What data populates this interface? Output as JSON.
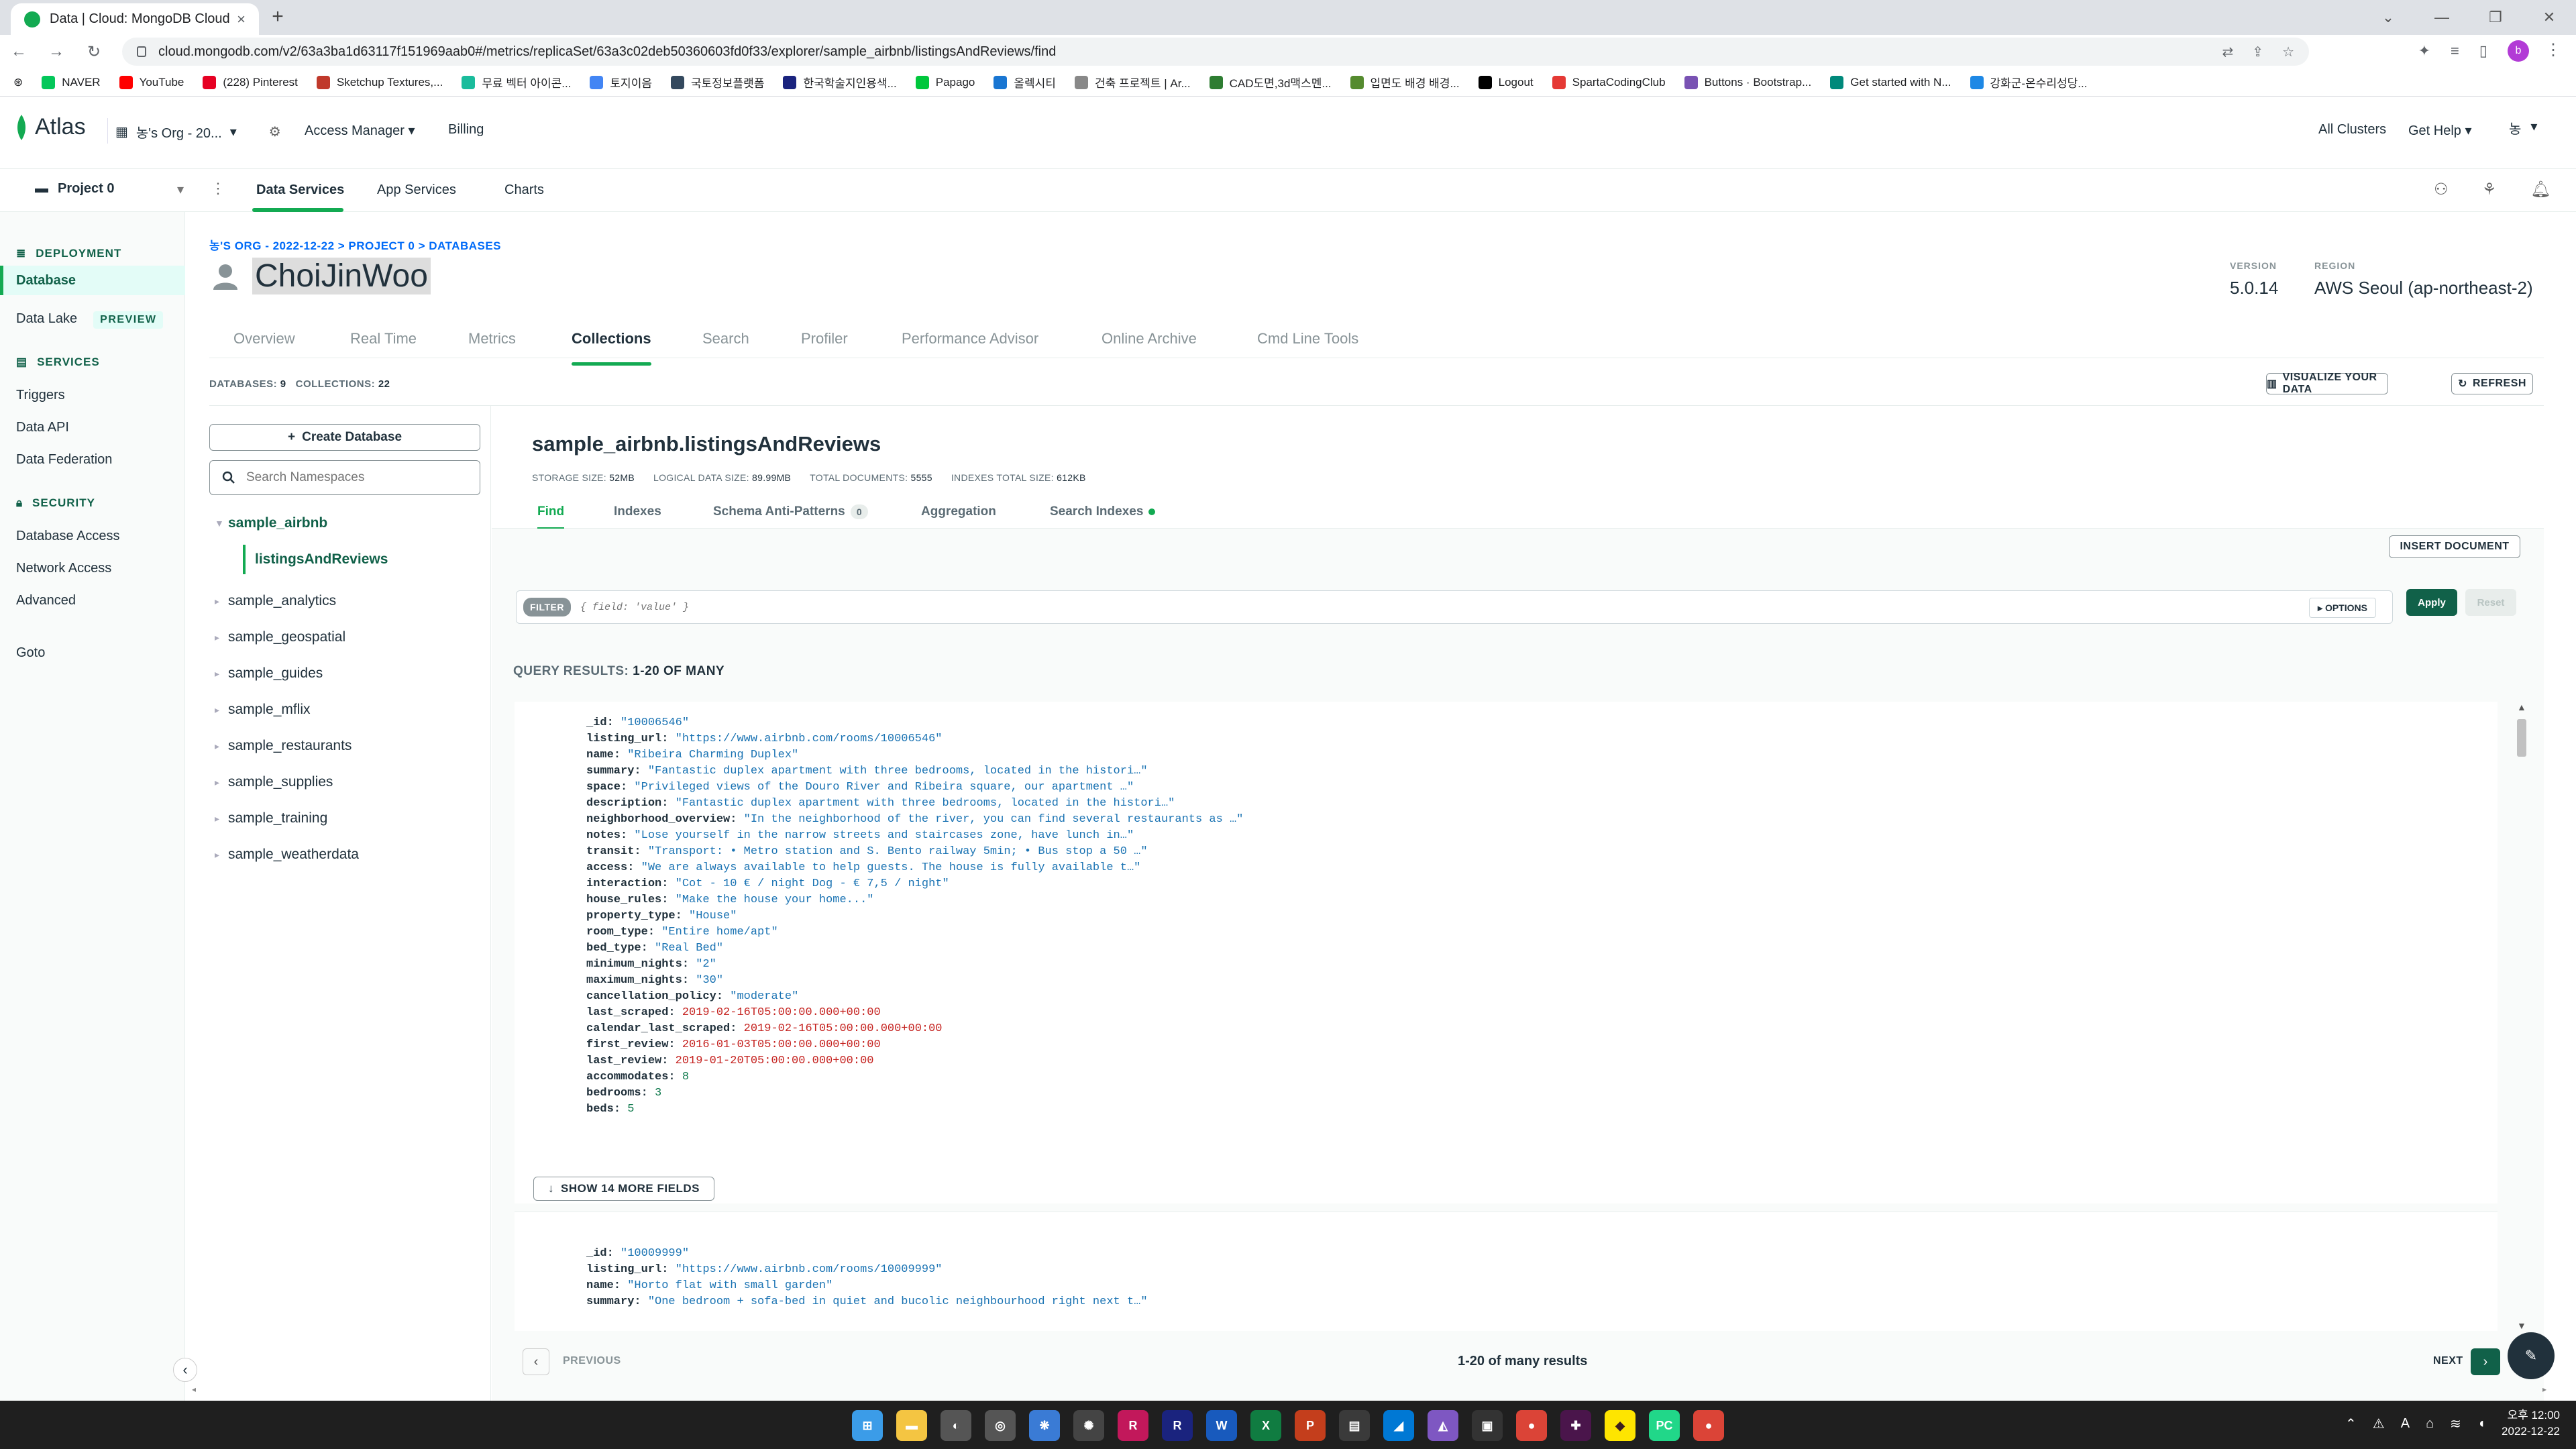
{
  "browser": {
    "tab_title": "Data | Cloud: MongoDB Cloud",
    "url": "cloud.mongodb.com/v2/63a3ba1d63117f151969aab0#/metrics/replicaSet/63a3c02deb50360603fd0f33/explorer/sample_airbnb/listingsAndReviews/find",
    "profile_initial": "b",
    "bookmarks": [
      {
        "label": "NAVER",
        "color": "#03c75a"
      },
      {
        "label": "YouTube",
        "color": "#ff0000"
      },
      {
        "label": "(228) Pinterest",
        "color": "#e60023"
      },
      {
        "label": "Sketchup Textures,...",
        "color": "#c0392b"
      },
      {
        "label": "무료 벡터 아이콘...",
        "color": "#1abc9c"
      },
      {
        "label": "토지이음",
        "color": "#4285f4"
      },
      {
        "label": "국토정보플랫폼",
        "color": "#34495e"
      },
      {
        "label": "한국학술지인용색...",
        "color": "#1a237e"
      },
      {
        "label": "Papago",
        "color": "#00c73c"
      },
      {
        "label": "올렉시티",
        "color": "#1976d2"
      },
      {
        "label": "건축 프로젝트 | Ar...",
        "color": "#888888"
      },
      {
        "label": "CAD도면,3d맥스멘...",
        "color": "#2e7d32"
      },
      {
        "label": "입면도 배경 배경...",
        "color": "#558b2f"
      },
      {
        "label": "Logout",
        "color": "#000000"
      },
      {
        "label": "SpartaCodingClub",
        "color": "#e53935"
      },
      {
        "label": "Buttons · Bootstrap...",
        "color": "#7952b3"
      },
      {
        "label": "Get started with N...",
        "color": "#00897b"
      },
      {
        "label": "강화군-온수리성당...",
        "color": "#1e88e5"
      }
    ]
  },
  "atlas": {
    "logo": "Atlas",
    "org": "농's Org - 20...",
    "access_manager": "Access Manager",
    "billing": "Billing",
    "all_clusters": "All Clusters",
    "get_help": "Get Help",
    "user_initial": "농",
    "project": "Project 0",
    "project_tabs": [
      "Data Services",
      "App Services",
      "Charts"
    ]
  },
  "sidebar": {
    "deployment": "DEPLOYMENT",
    "database": "Database",
    "data_lake": "Data Lake",
    "preview": "PREVIEW",
    "services": "SERVICES",
    "triggers": "Triggers",
    "data_api": "Data API",
    "data_federation": "Data Federation",
    "security": "SECURITY",
    "database_access": "Database Access",
    "network_access": "Network Access",
    "advanced": "Advanced",
    "goto": "Goto"
  },
  "cluster": {
    "breadcrumb": "농'S ORG - 2022-12-22 > PROJECT 0 > DATABASES",
    "name": "ChoiJinWoo",
    "version_label": "VERSION",
    "version": "5.0.14",
    "region_label": "REGION",
    "region": "AWS Seoul (ap-northeast-2)",
    "tabs": [
      "Overview",
      "Real Time",
      "Metrics",
      "Collections",
      "Search",
      "Profiler",
      "Performance Advisor",
      "Online Archive",
      "Cmd Line Tools"
    ],
    "databases_label": "DATABASES:",
    "databases_count": "9",
    "collections_label": "COLLECTIONS:",
    "collections_count": "22",
    "visualize_label": "VISUALIZE YOUR DATA",
    "refresh_label": "REFRESH"
  },
  "namespaces": {
    "create_db": "Create Database",
    "search_placeholder": "Search Namespaces",
    "active_db": "sample_airbnb",
    "active_collection": "listingsAndReviews",
    "databases": [
      "sample_analytics",
      "sample_geospatial",
      "sample_guides",
      "sample_mflix",
      "sample_restaurants",
      "sample_supplies",
      "sample_training",
      "sample_weatherdata"
    ]
  },
  "collection": {
    "name": "sample_airbnb.listingsAndReviews",
    "storage_size_label": "STORAGE SIZE:",
    "storage_size": "52MB",
    "logical_size_label": "LOGICAL DATA SIZE:",
    "logical_size": "89.99MB",
    "total_docs_label": "TOTAL DOCUMENTS:",
    "total_docs": "5555",
    "indexes_size_label": "INDEXES TOTAL SIZE:",
    "indexes_size": "612KB",
    "subtabs": [
      "Find",
      "Indexes",
      "Schema Anti-Patterns",
      "Aggregation",
      "Search Indexes"
    ],
    "anti_patterns_count": "0",
    "insert_document": "INSERT DOCUMENT",
    "filter_label": "FILTER",
    "filter_placeholder": "{ field: 'value' }",
    "options": "OPTIONS",
    "apply": "Apply",
    "reset": "Reset",
    "query_results_label": "QUERY RESULTS:",
    "query_results_range": "1-20 OF MANY",
    "show_more": "SHOW 14 MORE FIELDS",
    "previous": "PREVIOUS",
    "next": "NEXT",
    "pager_status": "1-20 of many results"
  },
  "documents": [
    {
      "fields": [
        {
          "k": "_id",
          "v": "\"10006546\"",
          "t": "s"
        },
        {
          "k": "listing_url",
          "v": "\"https://www.airbnb.com/rooms/10006546\"",
          "t": "s"
        },
        {
          "k": "name",
          "v": "\"Ribeira Charming Duplex\"",
          "t": "s"
        },
        {
          "k": "summary",
          "v": "\"Fantastic duplex apartment with three bedrooms, located in the histori…\"",
          "t": "s"
        },
        {
          "k": "space",
          "v": "\"Privileged views of the Douro River and Ribeira square, our apartment …\"",
          "t": "s"
        },
        {
          "k": "description",
          "v": "\"Fantastic duplex apartment with three bedrooms, located in the histori…\"",
          "t": "s"
        },
        {
          "k": "neighborhood_overview",
          "v": "\"In the neighborhood of the river, you can find several restaurants as …\"",
          "t": "s"
        },
        {
          "k": "notes",
          "v": "\"Lose yourself in the narrow streets and staircases zone, have lunch in…\"",
          "t": "s"
        },
        {
          "k": "transit",
          "v": "\"Transport: • Metro station and S. Bento railway 5min; • Bus stop a 50 …\"",
          "t": "s"
        },
        {
          "k": "access",
          "v": "\"We are always available to help guests. The house is fully available t…\"",
          "t": "s"
        },
        {
          "k": "interaction",
          "v": "\"Cot - 10 € / night Dog - € 7,5 / night\"",
          "t": "s"
        },
        {
          "k": "house_rules",
          "v": "\"Make the house your home...\"",
          "t": "s"
        },
        {
          "k": "property_type",
          "v": "\"House\"",
          "t": "s"
        },
        {
          "k": "room_type",
          "v": "\"Entire home/apt\"",
          "t": "s"
        },
        {
          "k": "bed_type",
          "v": "\"Real Bed\"",
          "t": "s"
        },
        {
          "k": "minimum_nights",
          "v": "\"2\"",
          "t": "s"
        },
        {
          "k": "maximum_nights",
          "v": "\"30\"",
          "t": "s"
        },
        {
          "k": "cancellation_policy",
          "v": "\"moderate\"",
          "t": "s"
        },
        {
          "k": "last_scraped",
          "v": "2019-02-16T05:00:00.000+00:00",
          "t": "d"
        },
        {
          "k": "calendar_last_scraped",
          "v": "2019-02-16T05:00:00.000+00:00",
          "t": "d"
        },
        {
          "k": "first_review",
          "v": "2016-01-03T05:00:00.000+00:00",
          "t": "d"
        },
        {
          "k": "last_review",
          "v": "2019-01-20T05:00:00.000+00:00",
          "t": "d"
        },
        {
          "k": "accommodates",
          "v": "8",
          "t": "n"
        },
        {
          "k": "bedrooms",
          "v": "3",
          "t": "n"
        },
        {
          "k": "beds",
          "v": "5",
          "t": "n"
        }
      ]
    },
    {
      "fields": [
        {
          "k": "_id",
          "v": "\"10009999\"",
          "t": "s"
        },
        {
          "k": "listing_url",
          "v": "\"https://www.airbnb.com/rooms/10009999\"",
          "t": "s"
        },
        {
          "k": "name",
          "v": "\"Horto flat with small garden\"",
          "t": "s"
        },
        {
          "k": "summary",
          "v": "\"One bedroom + sofa-bed in quiet and bucolic neighbourhood right next t…\"",
          "t": "s"
        }
      ]
    }
  ],
  "taskbar": {
    "time": "오후 12:00",
    "date": "2022-12-22",
    "ime": "A",
    "apps": [
      {
        "name": "windows-start",
        "color": "#3b9ce8",
        "g": "⊞"
      },
      {
        "name": "file-explorer",
        "color": "#f4c542",
        "g": "▬"
      },
      {
        "name": "app-circle-1",
        "color": "#555555",
        "g": "◐"
      },
      {
        "name": "app-circle-2",
        "color": "#555555",
        "g": "◎"
      },
      {
        "name": "app-blue",
        "color": "#3a7bd5",
        "g": "❋"
      },
      {
        "name": "app-gear",
        "color": "#444444",
        "g": "✺"
      },
      {
        "name": "app-rider",
        "color": "#c2185b",
        "g": "R"
      },
      {
        "name": "app-rider-blue",
        "color": "#1a237e",
        "g": "R"
      },
      {
        "name": "word",
        "color": "#185abd",
        "g": "W"
      },
      {
        "name": "excel",
        "color": "#107c41",
        "g": "X"
      },
      {
        "name": "powerpoint",
        "color": "#c43e1c",
        "g": "P"
      },
      {
        "name": "app-folder",
        "color": "#3a3a3a",
        "g": "▤"
      },
      {
        "name": "app-azure",
        "color": "#0078d4",
        "g": "◢"
      },
      {
        "name": "app-affinity",
        "color": "#7e57c2",
        "g": "◭"
      },
      {
        "name": "app-terminal",
        "color": "#333333",
        "g": "▣"
      },
      {
        "name": "chrome-1",
        "color": "#db4437",
        "g": "●"
      },
      {
        "name": "slack",
        "color": "#4a154b",
        "g": "✚"
      },
      {
        "name": "kakaotalk",
        "color": "#fee500",
        "g": "◆"
      },
      {
        "name": "pycharm",
        "color": "#21d789",
        "g": "PC"
      },
      {
        "name": "chrome-2",
        "color": "#db4437",
        "g": "●"
      }
    ]
  }
}
